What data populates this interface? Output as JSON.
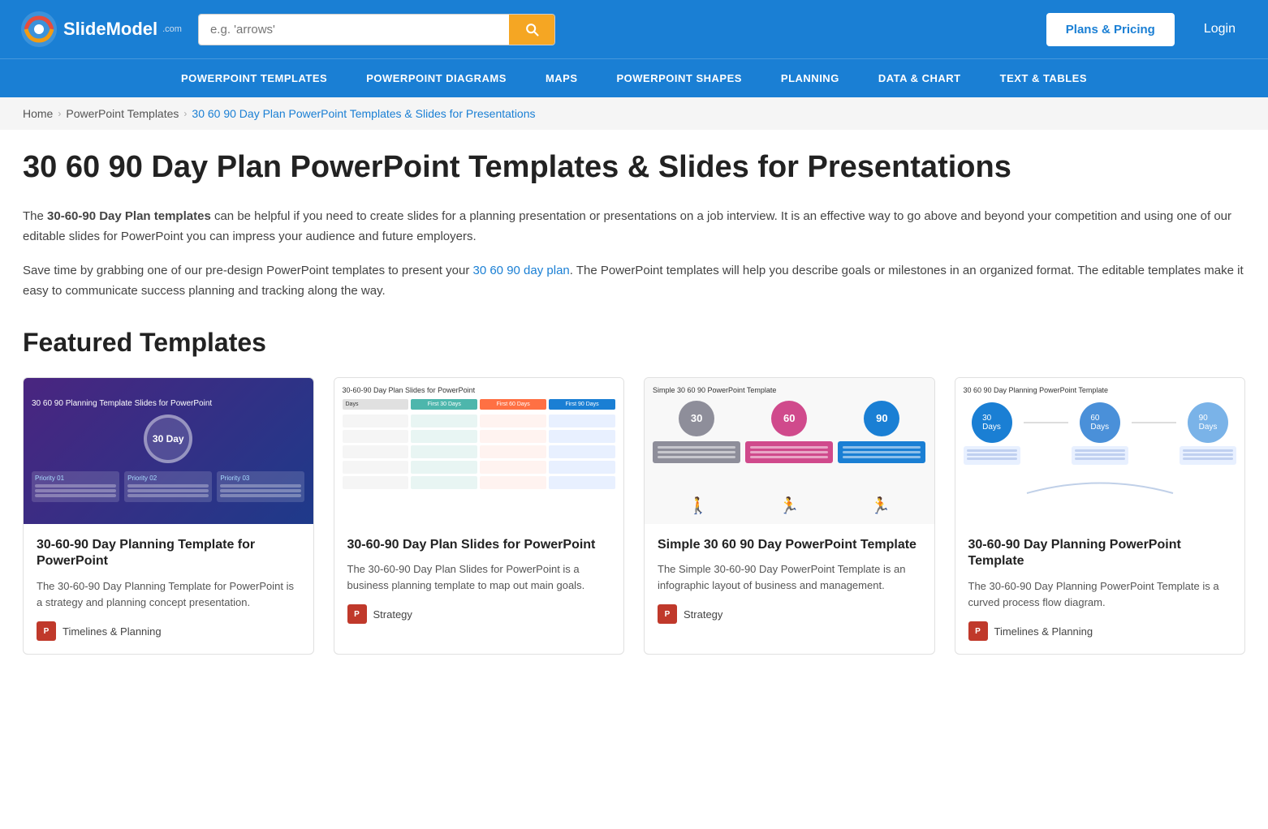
{
  "header": {
    "logo_text": "SlideModel",
    "logo_com": ".com",
    "search_placeholder": "e.g. 'arrows'",
    "plans_btn": "Plans & Pricing",
    "login_btn": "Login"
  },
  "nav": {
    "items": [
      "POWERPOINT TEMPLATES",
      "POWERPOINT DIAGRAMS",
      "MAPS",
      "POWERPOINT SHAPES",
      "PLANNING",
      "DATA & CHART",
      "TEXT & TABLES"
    ]
  },
  "breadcrumb": {
    "home": "Home",
    "parent": "PowerPoint Templates",
    "current": "30 60 90 Day Plan PowerPoint Templates & Slides for Presentations"
  },
  "page": {
    "title": "30 60 90 Day Plan PowerPoint Templates & Slides for Presentations",
    "desc1_prefix": "The ",
    "desc1_bold": "30-60-90 Day Plan templates",
    "desc1_suffix": " can be helpful if you need to create slides for a planning presentation or presentations on a job interview. It is an effective way to go above and beyond your competition and using one of our editable slides for PowerPoint you can impress your audience and future employers.",
    "desc2_prefix": "Save time by grabbing one of our pre-design PowerPoint templates to present your ",
    "desc2_link": "30 60 90 day plan",
    "desc2_suffix": ". The PowerPoint templates will help you describe goals or milestones in an organized format. The editable templates make it easy to communicate success planning and tracking along the way.",
    "featured_title": "Featured Templates"
  },
  "templates": [
    {
      "name": "30-60-90 Day Planning Template for PowerPoint",
      "desc": "The 30-60-90 Day Planning Template for PowerPoint is a strategy and planning concept presentation.",
      "tag": "Timelines & Planning",
      "thumb_type": "1",
      "thumb_label": "30 60 90 Planning Template Slides for PowerPoint"
    },
    {
      "name": "30-60-90 Day Plan Slides for PowerPoint",
      "desc": "The 30-60-90 Day Plan Slides for PowerPoint is a business planning template to map out main goals.",
      "tag": "Strategy",
      "thumb_type": "2",
      "thumb_label": "30-60-90 Day Plan Slides for PowerPoint"
    },
    {
      "name": "Simple 30 60 90 Day PowerPoint Template",
      "desc": "The Simple 30-60-90 Day PowerPoint Template is an infographic layout of business and management.",
      "tag": "Strategy",
      "thumb_type": "3",
      "thumb_label": "Simple 30 60 90 PowerPoint Template"
    },
    {
      "name": "30-60-90 Day Planning PowerPoint Template",
      "desc": "The 30-60-90 Day Planning PowerPoint Template is a curved process flow diagram.",
      "tag": "Timelines & Planning",
      "thumb_type": "4",
      "thumb_label": "30 60 90 Day Planning PowerPoint Template"
    }
  ],
  "colors": {
    "header_bg": "#1a7fd4",
    "accent": "#f5a623",
    "thumb2_col1": "#4db6ac",
    "thumb2_col2": "#ff7043",
    "thumb2_col3": "#1a7fd4",
    "thumb3_circle1": "#8e8e9a",
    "thumb3_circle2": "#d04a8c",
    "thumb3_circle3": "#1a7fd4"
  }
}
